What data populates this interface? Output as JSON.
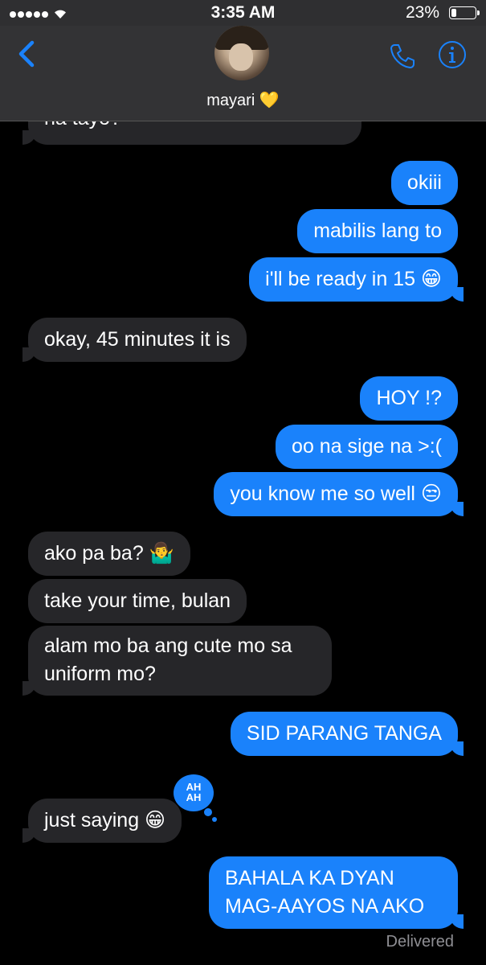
{
  "status_bar": {
    "time": "3:35 AM",
    "battery": "23%",
    "battery_level": 0.23
  },
  "header": {
    "contact_name": "mayari",
    "name_emoji": "💛"
  },
  "messages": [
    {
      "from": "them",
      "text": "na tayo?"
    },
    {
      "from": "me",
      "text": "okiii"
    },
    {
      "from": "me",
      "text": "mabilis lang to"
    },
    {
      "from": "me",
      "text": "i'll be ready in 15 😁"
    },
    {
      "from": "them",
      "text": "okay, 45 minutes it is"
    },
    {
      "from": "me",
      "text": "HOY !?"
    },
    {
      "from": "me",
      "text": "oo na sige na >:("
    },
    {
      "from": "me",
      "text": "you know me so well 😒"
    },
    {
      "from": "them",
      "text": "ako pa ba? 🤷‍♂️"
    },
    {
      "from": "them",
      "text": "take your time, bulan"
    },
    {
      "from": "them",
      "text": "alam mo ba ang cute mo sa uniform mo?"
    },
    {
      "from": "me",
      "text": "SID PARANG TANGA"
    },
    {
      "from": "them",
      "text": "just saying 😁",
      "reaction": "AH AH"
    },
    {
      "from": "me",
      "text": "BAHALA KA DYAN MAG-AAYOS NA AKO"
    }
  ],
  "reaction_label": "AH AH",
  "delivered_label": "Delivered",
  "colors": {
    "sent_bubble": "#1a82fb",
    "received_bubble": "#262629",
    "background": "#000000"
  },
  "icons": [
    "back-chevron-icon",
    "phone-icon",
    "info-icon",
    "wifi-icon",
    "battery-icon"
  ]
}
